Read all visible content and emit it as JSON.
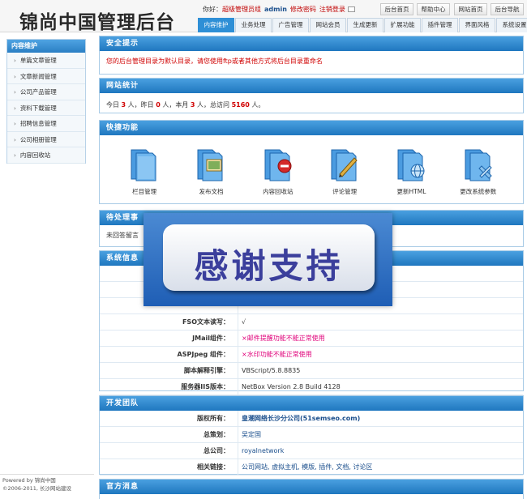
{
  "header": {
    "logo": "锦尚中国管理后台",
    "hello": "你好：",
    "role": "超级管理员组",
    "user": "admin",
    "change_password": "修改密码",
    "logout": "注销登录",
    "quick_links": [
      "后台首页",
      "帮助中心",
      "网站首页",
      "后台导航"
    ],
    "tabs": [
      "内容维护",
      "业务处理",
      "广告管理",
      "网站会员",
      "生成更新",
      "扩展功能",
      "插件管理",
      "界面风格",
      "系统设置"
    ]
  },
  "sidebar": {
    "title": "内容维护",
    "items": [
      {
        "label": "单篇文章管理"
      },
      {
        "label": "文章新闻管理"
      },
      {
        "label": "公司产品管理"
      },
      {
        "label": "资料下载管理"
      },
      {
        "label": "招聘信息管理"
      },
      {
        "label": "公司相册管理"
      },
      {
        "label": "内容回收站"
      }
    ],
    "footer_line1": "Powered by 锦尚中国",
    "footer_line2": "©2006-2011, 长沙网站建设"
  },
  "security": {
    "title": "安全提示",
    "notice": "您的后台管理目录为默认目录，请您使用ftp或者其他方式将后台目录重命名"
  },
  "stats": {
    "title": "网站统计",
    "today_label": "今日",
    "today": "3",
    "yesterday_label": "人，昨日",
    "yesterday": "0",
    "month_label": "人，本月",
    "month": "3",
    "total_label": "人，总访问",
    "total": "5160",
    "end": "人。"
  },
  "quick": {
    "title": "快捷功能",
    "items": [
      {
        "label": "栏目管理",
        "icon": "folder-icon"
      },
      {
        "label": "发布文档",
        "icon": "picture-folder-icon"
      },
      {
        "label": "内容回收站",
        "icon": "delete-folder-icon"
      },
      {
        "label": "评论管理",
        "icon": "edit-folder-icon"
      },
      {
        "label": "更新HTML",
        "icon": "globe-folder-icon"
      },
      {
        "label": "更改系统参数",
        "icon": "settings-folder-icon"
      }
    ]
  },
  "pending": {
    "title": "待处理事",
    "text": "未回答留言"
  },
  "system": {
    "title": "系统信息",
    "partial_value": "",
    "rows": [
      {
        "label": "FSO文本读写：",
        "value": "√",
        "color": "#333333"
      },
      {
        "label": "JMail组件：",
        "value": "×邮件提醒功能不能正常使用",
        "color": "#e0007a"
      },
      {
        "label": "ASPJpeg 组件：",
        "value": "×水印功能不能正常使用",
        "color": "#e0007a"
      },
      {
        "label": "脚本解释引擎：",
        "value": "VBScript/5.8.8835",
        "color": "#333333"
      },
      {
        "label": "服务器IIS版本：",
        "value": "NetBox Version 2.8 Build 4128",
        "color": "#333333"
      }
    ]
  },
  "team": {
    "title": "开发团队",
    "rows": [
      {
        "label": "版权所有：",
        "value": "皇潮网络长沙分公司(51semseo.com)"
      },
      {
        "label": "总策划：",
        "value": "吴定国"
      },
      {
        "label": "总公司：",
        "value": "royalnetwork"
      },
      {
        "label": "相关链接：",
        "value": "公司网站, 虚拟主机, 模版, 插件, 文档, 讨论区"
      }
    ]
  },
  "official": {
    "title": "官方消息"
  },
  "overlay": {
    "text": "感谢支持"
  },
  "colors": {
    "accent": "#2e8fd6",
    "warning": "#d00000",
    "brand": "#1f77bf"
  }
}
